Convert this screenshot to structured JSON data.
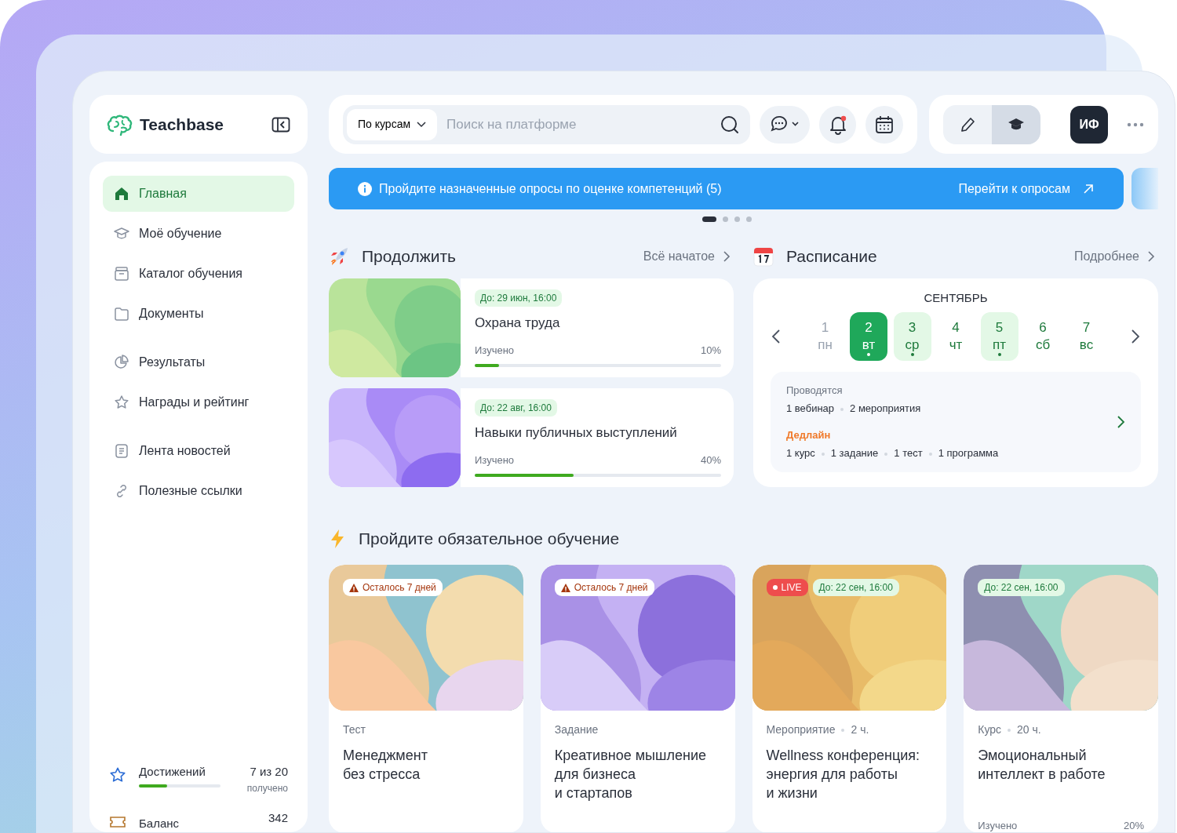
{
  "sidebar": {
    "logo": "Teachbase",
    "nav_groups": [
      [
        {
          "label": "Главная",
          "selected": true
        },
        {
          "label": "Моё обучение",
          "selected": false
        },
        {
          "label": "Каталог обучения",
          "selected": false
        },
        {
          "label": "Документы",
          "selected": false
        }
      ],
      [
        {
          "label": "Результаты",
          "selected": false
        },
        {
          "label": "Награды и рейтинг",
          "selected": false
        }
      ],
      [
        {
          "label": "Лента новостей",
          "selected": false
        },
        {
          "label": "Полезные ссылки",
          "selected": false
        }
      ]
    ],
    "achievements": {
      "label": "Достижений",
      "value": "7 из 20",
      "sub": "получено",
      "level": 0.35
    },
    "balance": {
      "label": "Баланс",
      "value": "342"
    }
  },
  "search": {
    "scope": "По курсам",
    "placeholder": "Поиск на платформе"
  },
  "notifications": {
    "unread": true
  },
  "modes": [
    {
      "kind": "edit",
      "selected": false
    },
    {
      "kind": "learn",
      "selected": true
    }
  ],
  "avatar": "ИФ",
  "banner": {
    "text": "Пройдите назначенные опросы по оценке компетенций (5)",
    "action": "Перейти к опросам"
  },
  "carousel_dots": [
    {
      "selected": true
    },
    {
      "selected": false
    },
    {
      "selected": false
    },
    {
      "selected": false
    }
  ],
  "continue": {
    "title": "Продолжить",
    "link": "Всё начатое",
    "items": [
      {
        "deadline": "До: 29 июн, 16:00",
        "title": "Охрана труда",
        "progress_label": "Изучено",
        "percent": "10%",
        "level": 0.1
      },
      {
        "deadline": "До: 22 авг, 16:00",
        "title": "Навыки публичных выступлений",
        "progress_label": "Изучено",
        "percent": "40%",
        "level": 0.4
      }
    ]
  },
  "schedule": {
    "title": "Расписание",
    "link": "Подробнее",
    "month": "СЕНТЯБРЬ",
    "days": [
      {
        "number": "1",
        "weekday": "пн",
        "selected": false,
        "disabled": true,
        "has_events": false
      },
      {
        "number": "2",
        "weekday": "вт",
        "selected": true,
        "disabled": false,
        "has_events": true
      },
      {
        "number": "3",
        "weekday": "ср",
        "selected": false,
        "disabled": false,
        "has_events": true
      },
      {
        "number": "4",
        "weekday": "чт",
        "selected": false,
        "disabled": false,
        "has_events": false
      },
      {
        "number": "5",
        "weekday": "пт",
        "selected": false,
        "disabled": false,
        "has_events": true
      },
      {
        "number": "6",
        "weekday": "сб",
        "selected": false,
        "disabled": false,
        "has_events": false
      },
      {
        "number": "7",
        "weekday": "вс",
        "selected": false,
        "disabled": false,
        "has_events": false
      }
    ],
    "running_label": "Проводятся",
    "running": [
      "1 вебинар",
      "2 мероприятия"
    ],
    "deadline_label": "Дедлайн",
    "deadlines": [
      "1 курс",
      "1 задание",
      "1 тест",
      "1 программа"
    ]
  },
  "required": {
    "title": "Пройдите обязательное обучение",
    "items": [
      {
        "badges": [
          {
            "kind": "warning",
            "text": "Осталось 7 дней"
          }
        ],
        "type": "Тест",
        "title": "Менеджмент\nбез стресса"
      },
      {
        "badges": [
          {
            "kind": "warning",
            "text": "Осталось 7 дней"
          }
        ],
        "type": "Задание",
        "title": "Креативное мышление\nдля бизнеса\nи стартапов"
      },
      {
        "badges": [
          {
            "kind": "live",
            "text": "LIVE"
          },
          {
            "kind": "deadline",
            "text": "До: 22 сен, 16:00"
          }
        ],
        "type": "Мероприятие",
        "duration": "2 ч.",
        "title": "Wellness конференция:\nэнергия для работы\nи жизни"
      },
      {
        "badges": [
          {
            "kind": "deadline",
            "text": "До: 22 сен, 16:00"
          }
        ],
        "type": "Курс",
        "duration": "20 ч.",
        "title": "Эмоциональный\nинтеллект в работе",
        "progress_label": "Изучено",
        "percent": "20%"
      }
    ]
  }
}
